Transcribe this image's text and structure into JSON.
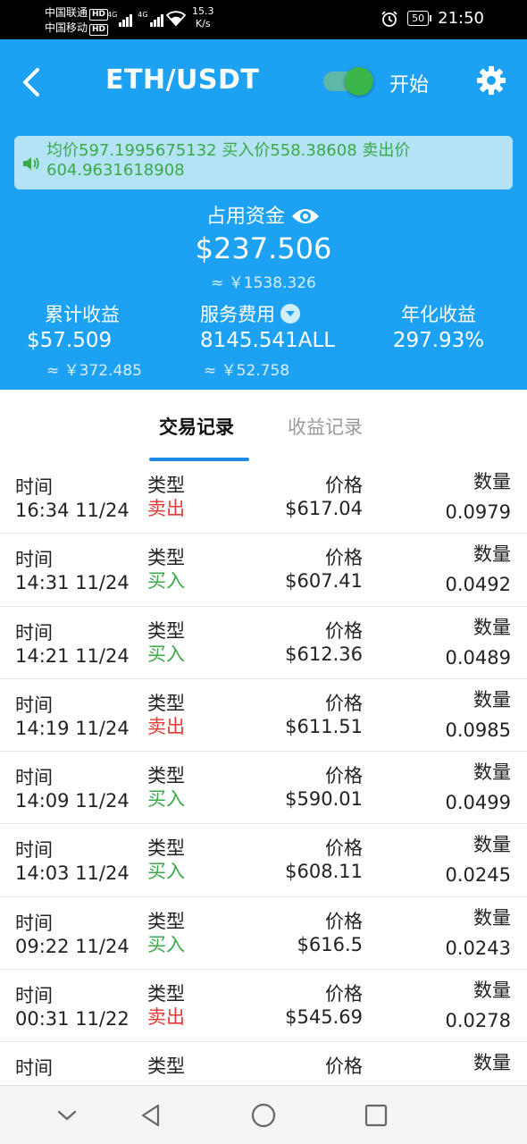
{
  "status_bar": {
    "carrier1": "中国联通",
    "carrier2": "中国移动",
    "hd": "HD",
    "network1": "4G",
    "network2": "4G",
    "speed_value": "15.3",
    "speed_unit": "K/s",
    "battery": "50",
    "time": "21:50"
  },
  "header": {
    "title": "ETH/USDT",
    "toggle_label": "开始",
    "toggle_on": true,
    "notice": "均价597.1995675132 买入价558.38608 卖出价604.9631618908",
    "capital_label": "占用资金",
    "capital_value": "$237.506",
    "capital_cny": "≈ ￥1538.326",
    "stats": [
      {
        "label": "累计收益",
        "value": "$57.509",
        "sub": "≈ ￥372.485"
      },
      {
        "label": "服务费用",
        "value": "8145.541ALL",
        "sub": "≈ ￥52.758"
      },
      {
        "label": "年化收益",
        "value": "297.93%"
      }
    ]
  },
  "tabs": {
    "active": "交易记录",
    "inactive": "收益记录"
  },
  "labels": {
    "time": "时间",
    "type": "类型",
    "price": "价格",
    "qty": "数量"
  },
  "colors": {
    "primary": "#1da1f2",
    "sell": "#e53935",
    "buy": "#3aa94a",
    "tab_underline": "#1e88e5"
  },
  "records": [
    {
      "time": "16:34 11/24",
      "type": "卖出",
      "side": "sell",
      "price": "$617.04",
      "qty": "0.0979"
    },
    {
      "time": "14:31 11/24",
      "type": "买入",
      "side": "buy",
      "price": "$607.41",
      "qty": "0.0492"
    },
    {
      "time": "14:21 11/24",
      "type": "买入",
      "side": "buy",
      "price": "$612.36",
      "qty": "0.0489"
    },
    {
      "time": "14:19 11/24",
      "type": "卖出",
      "side": "sell",
      "price": "$611.51",
      "qty": "0.0985"
    },
    {
      "time": "14:09 11/24",
      "type": "买入",
      "side": "buy",
      "price": "$590.01",
      "qty": "0.0499"
    },
    {
      "time": "14:03 11/24",
      "type": "买入",
      "side": "buy",
      "price": "$608.11",
      "qty": "0.0245"
    },
    {
      "time": "09:22 11/24",
      "type": "买入",
      "side": "buy",
      "price": "$616.5",
      "qty": "0.0243"
    },
    {
      "time": "00:31 11/22",
      "type": "卖出",
      "side": "sell",
      "price": "$545.69",
      "qty": "0.0278"
    },
    {
      "time": "",
      "type": "",
      "side": "buy",
      "price": "",
      "qty": ""
    }
  ],
  "icons": {
    "back": "back-arrow-icon",
    "settings": "gear-icon",
    "speaker": "speaker-icon",
    "eye": "eye-icon",
    "dropdown": "chevron-down-icon",
    "nav_down": "chevron-down-icon",
    "nav_back": "triangle-back-icon",
    "nav_home": "circle-home-icon",
    "nav_recent": "square-recent-icon"
  }
}
